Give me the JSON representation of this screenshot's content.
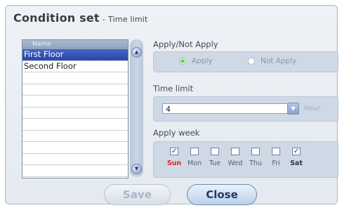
{
  "dialog": {
    "title": "Condition set",
    "separator": "-",
    "subtitle": "Time limit"
  },
  "list": {
    "header": "Name",
    "items": [
      "First Floor",
      "Second Floor",
      "",
      "",
      "",
      "",
      "",
      "",
      "",
      "",
      ""
    ],
    "selected_index": 0
  },
  "apply": {
    "label": "Apply/Not Apply",
    "options": [
      "Apply",
      "Not Apply"
    ],
    "selected": "Apply"
  },
  "time_limit": {
    "label": "Time limit",
    "value": "4",
    "unit": "Hour"
  },
  "apply_week": {
    "label": "Apply week",
    "days": [
      {
        "label": "Sun",
        "checked": true
      },
      {
        "label": "Mon",
        "checked": false
      },
      {
        "label": "Tue",
        "checked": false
      },
      {
        "label": "Wed",
        "checked": false
      },
      {
        "label": "Thu",
        "checked": false
      },
      {
        "label": "Fri",
        "checked": false
      },
      {
        "label": "Sat",
        "checked": true
      }
    ],
    "check_glyph": "✓"
  },
  "buttons": {
    "save": "Save",
    "close": "Close"
  },
  "colors": {
    "selected_row": "#2f4bb0",
    "sunday": "#d62828",
    "radio_on": "#46d93a"
  }
}
